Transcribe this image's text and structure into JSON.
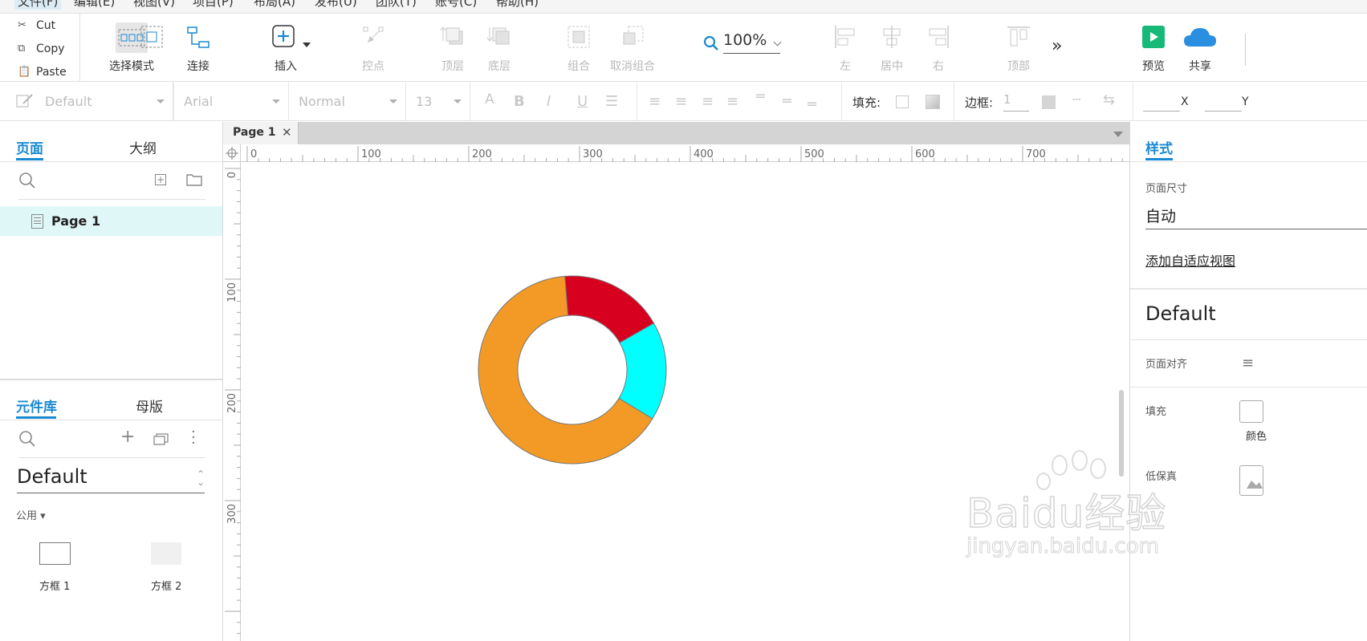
{
  "menu": {
    "items": [
      {
        "label": "文件(F)"
      },
      {
        "label": "编辑(E)"
      },
      {
        "label": "视图(V)"
      },
      {
        "label": "项目(P)"
      },
      {
        "label": "布局(A)"
      },
      {
        "label": "发布(U)"
      },
      {
        "label": "团队(T)"
      },
      {
        "label": "账号(C)"
      },
      {
        "label": "帮助(H)"
      }
    ]
  },
  "clipboard": {
    "cut": "Cut",
    "copy": "Copy",
    "paste": "Paste"
  },
  "toolbar": {
    "select_mode": "选择模式",
    "connect": "连接",
    "insert": "插入",
    "point": "控点",
    "top_layer": "顶层",
    "bottom_layer": "底层",
    "group": "组合",
    "ungroup": "取消组合",
    "zoom": "100%",
    "align_left": "左",
    "align_center": "居中",
    "align_right": "右",
    "align_top": "顶部",
    "preview": "预览",
    "share": "共享"
  },
  "format": {
    "style": "Default",
    "font": "Arial",
    "weight": "Normal",
    "size": "13",
    "fill_label": "填充:",
    "border_label": "边框:",
    "border_value": "1",
    "x_label": "X",
    "y_label": "Y"
  },
  "left_panel": {
    "tabs": {
      "pages": "页面",
      "outline": "大纲"
    },
    "pages": [
      {
        "label": "Page 1"
      }
    ],
    "lib_tabs": {
      "library": "元件库",
      "masters": "母版"
    },
    "library_name": "Default",
    "category": "公用 ▾",
    "widgets": [
      {
        "label": "方框 1"
      },
      {
        "label": "方框 2"
      }
    ]
  },
  "canvas": {
    "tab_label": "Page 1",
    "hruler_ticks": [
      "0",
      "100",
      "200",
      "300",
      "400",
      "500",
      "600",
      "700"
    ],
    "vruler_ticks": [
      "0",
      "100",
      "200",
      "300"
    ],
    "donut": {
      "segments": [
        {
          "value": 0.18,
          "color": "#d7001f"
        },
        {
          "value": 0.17,
          "color": "#00ffff"
        },
        {
          "value": 0.65,
          "color": "#f39a26"
        }
      ]
    }
  },
  "right_panel": {
    "tab": "样式",
    "page_size_label": "页面尺寸",
    "page_size_value": "自动",
    "adaptive_link": "添加自适应视图",
    "style_name": "Default",
    "page_align_label": "页面对齐",
    "fill_label": "填充",
    "fill_color_label": "颜色",
    "low_fidelity_label": "低保真"
  },
  "watermark": {
    "brand": "Baidu经验",
    "url": "jingyan.baidu.com"
  },
  "colors": {
    "accent": "#1a8ad1",
    "preview_green": "#17b978",
    "share_blue": "#2a8fe0"
  }
}
